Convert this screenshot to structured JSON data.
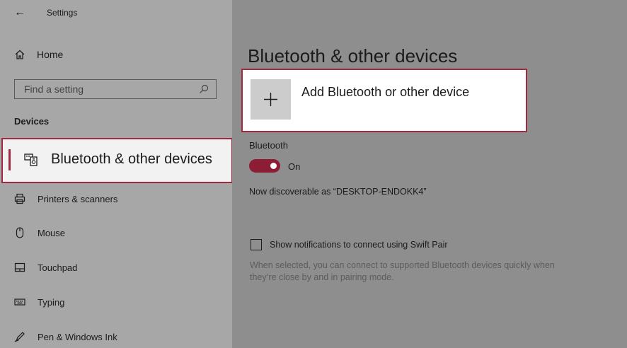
{
  "window": {
    "title": "Settings"
  },
  "sidebar": {
    "home_label": "Home",
    "search_placeholder": "Find a setting",
    "section_label": "Devices",
    "items": [
      {
        "label": "Bluetooth & other devices",
        "icon": "bluetooth-devices-icon",
        "selected": true
      },
      {
        "label": "Printers & scanners",
        "icon": "printer-icon"
      },
      {
        "label": "Mouse",
        "icon": "mouse-icon"
      },
      {
        "label": "Touchpad",
        "icon": "touchpad-icon"
      },
      {
        "label": "Typing",
        "icon": "keyboard-icon"
      },
      {
        "label": "Pen & Windows Ink",
        "icon": "pen-icon"
      }
    ]
  },
  "main": {
    "title": "Bluetooth & other devices",
    "add_device_label": "Add Bluetooth or other device",
    "bluetooth_heading": "Bluetooth",
    "bluetooth_toggle_state": "On",
    "discoverable_text": "Now discoverable as “DESKTOP-ENDOKK4”",
    "swift_pair_label": "Show notifications to connect using Swift Pair",
    "swift_pair_checked": false,
    "swift_pair_help": "When selected, you can connect to supported Bluetooth devices quickly when they’re close by and in pairing mode."
  },
  "colors": {
    "accent": "#a32940",
    "toggle_on": "#8d1d35",
    "highlight_bg": "#ffffff"
  }
}
